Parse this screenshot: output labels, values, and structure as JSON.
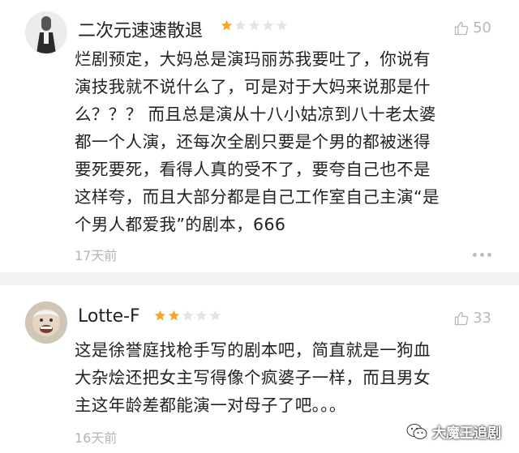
{
  "reviews": [
    {
      "username": "二次元速速散退",
      "rating": 1,
      "max_rating": 5,
      "likes": "50",
      "lines": [
        "烂剧预定，大妈总是演玛丽苏我要吐了，你说有",
        "演技我就不说什么了，可是对于大妈来说那是什",
        "么？？？ 而且总是演从十八小姑凉到八十老太婆",
        "都一个人演，还每次全剧只要是个男的都被迷得",
        "要死要死，看得人真的受不了，要夸自己也不是",
        "这样夸，而且大部分都是自己工作室自己主演“是",
        "个男人都爱我”的剧本，666"
      ],
      "time": "17天前"
    },
    {
      "username": "Lotte-F",
      "rating": 2,
      "max_rating": 5,
      "likes": "33",
      "lines": [
        "这是徐誉庭找枪手写的剧本吧，简直就是一狗血",
        "大杂烩还把女主写得像个疯婆子一样，而且男女",
        "主这年龄差都能演一对母子了吧。。。"
      ],
      "time": "16天前"
    }
  ],
  "colors": {
    "star_filled": "#f5a623",
    "star_empty": "#e3e3e3",
    "meta_gray": "#b5b5b5"
  },
  "watermark": "大魔王追剧"
}
